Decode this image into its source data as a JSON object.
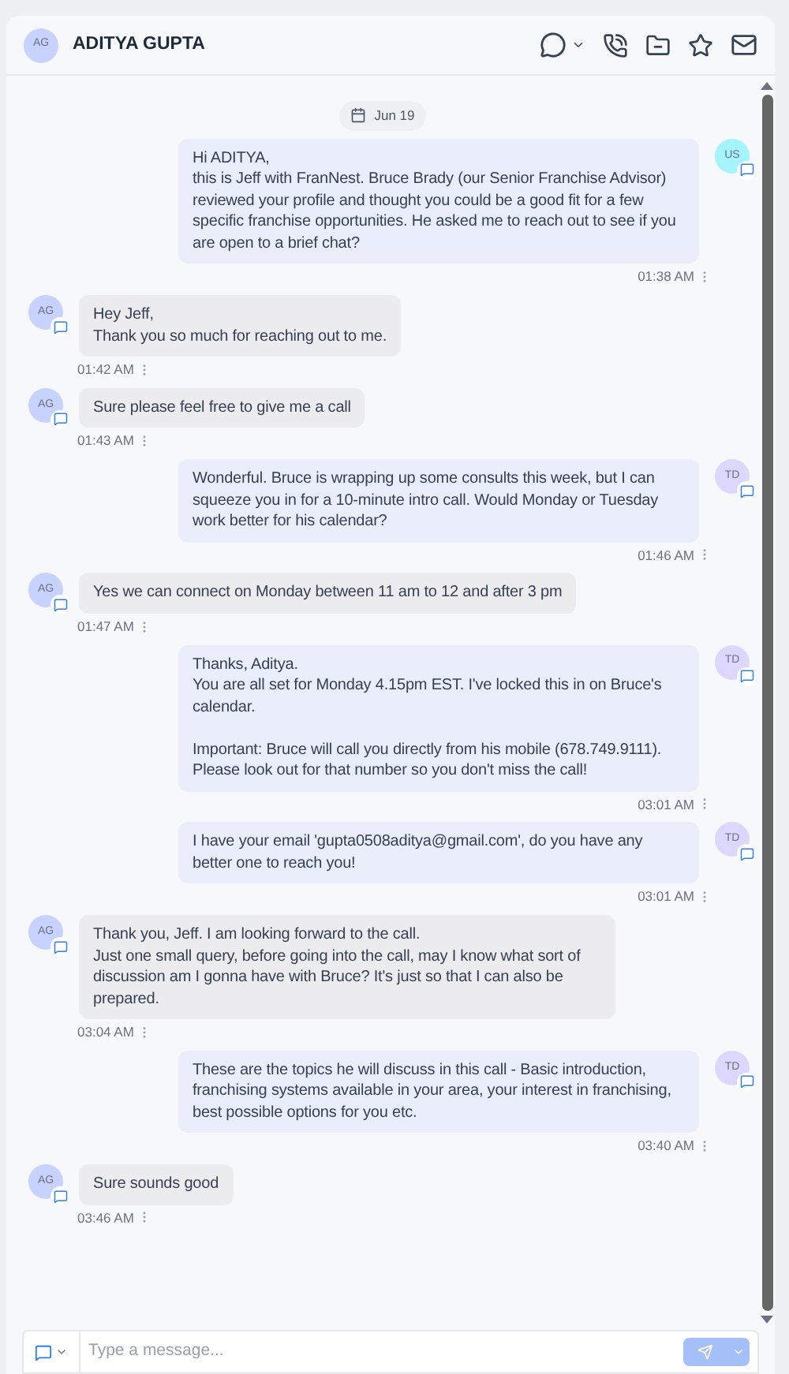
{
  "header": {
    "initials": "AG",
    "name": "ADITYA GUPTA"
  },
  "date": "Jun 19",
  "messages": [
    {
      "kind": "out",
      "initials": "US",
      "color": "#a5f3fc",
      "text": "Hi ADITYA,\nthis is Jeff with FranNest. Bruce Brady (our Senior Franchise Advisor) reviewed your profile and thought you could be a good fit for a few specific franchise opportunities. He asked me to reach out to see if you are open to a brief chat?",
      "time": "01:38 AM"
    },
    {
      "kind": "in",
      "initials": "AG",
      "color": "#c7d2fe",
      "text": "Hey Jeff,\nThank you so much for reaching out to me.",
      "time": "01:42 AM"
    },
    {
      "kind": "in",
      "initials": "AG",
      "color": "#c7d2fe",
      "text": "Sure please feel free to give me a call",
      "time": "01:43 AM"
    },
    {
      "kind": "out",
      "initials": "TD",
      "color": "#ddd6fe",
      "text": "Wonderful. Bruce is wrapping up some consults this week, but I can squeeze you in for a 10-minute intro call. Would Monday or Tuesday work better for his calendar?",
      "time": "01:46 AM"
    },
    {
      "kind": "in",
      "initials": "AG",
      "color": "#c7d2fe",
      "text": "Yes we can connect on Monday between 11 am to 12 and after 3 pm",
      "time": "01:47 AM"
    },
    {
      "kind": "out",
      "initials": "TD",
      "color": "#ddd6fe",
      "text": "Thanks, Aditya.\nYou are all set for Monday 4.15pm EST. I've locked this in on Bruce's calendar.\n\nImportant: Bruce will call you directly from his mobile (678.749.9111). Please look out for that number so you don't miss the call!",
      "time": "03:01 AM"
    },
    {
      "kind": "out",
      "initials": "TD",
      "color": "#ddd6fe",
      "text": "I have your email 'gupta0508aditya@gmail.com', do you have any better one to reach you!",
      "time": "03:01 AM"
    },
    {
      "kind": "in",
      "initials": "AG",
      "color": "#c7d2fe",
      "text": "Thank you, Jeff. I am looking forward to the call.\nJust one small query, before going into the call, may I know what sort of discussion am I gonna have with Bruce? It's just so that I can also be prepared.",
      "time": "03:04 AM"
    },
    {
      "kind": "out",
      "initials": "TD",
      "color": "#ddd6fe",
      "text": "These are the topics he will discuss in this call - Basic introduction, franchising systems available in your area, your interest in franchising, best possible options for you etc.",
      "time": "03:40 AM"
    },
    {
      "kind": "in",
      "initials": "AG",
      "color": "#c7d2fe",
      "text": "Sure sounds good",
      "time": "03:46 AM"
    }
  ],
  "composer": {
    "placeholder": "Type a message..."
  }
}
